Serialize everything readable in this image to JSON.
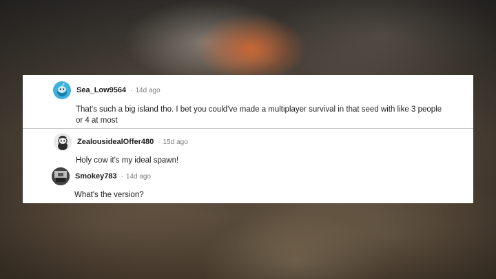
{
  "comments": [
    {
      "username": "Sea_Low9564",
      "separator": "·",
      "time": "14d ago",
      "avatar_icon": "snoo-avatar-blue-icon",
      "text_lines": [
        "That's such a big island tho. I bet you could've made a multiplayer survival in that seed with like 3 people",
        "or 4 at most"
      ]
    },
    {
      "username": "ZealousidealOffer480",
      "separator": "·",
      "time": "15d ago",
      "avatar_icon": "snoo-avatar-dark-icon",
      "text_lines": [
        "Holy cow it's my ideal spawn!"
      ]
    },
    {
      "username": "Smokey783",
      "separator": "·",
      "time": "14d ago",
      "avatar_icon": "photo-avatar-icon",
      "text_lines": [
        "What's the version?"
      ]
    }
  ],
  "colors": {
    "panel": "#ffffff",
    "username": "#1c1c1c",
    "meta": "#7c7c7c",
    "avatar_blue": "#3db2dc"
  }
}
